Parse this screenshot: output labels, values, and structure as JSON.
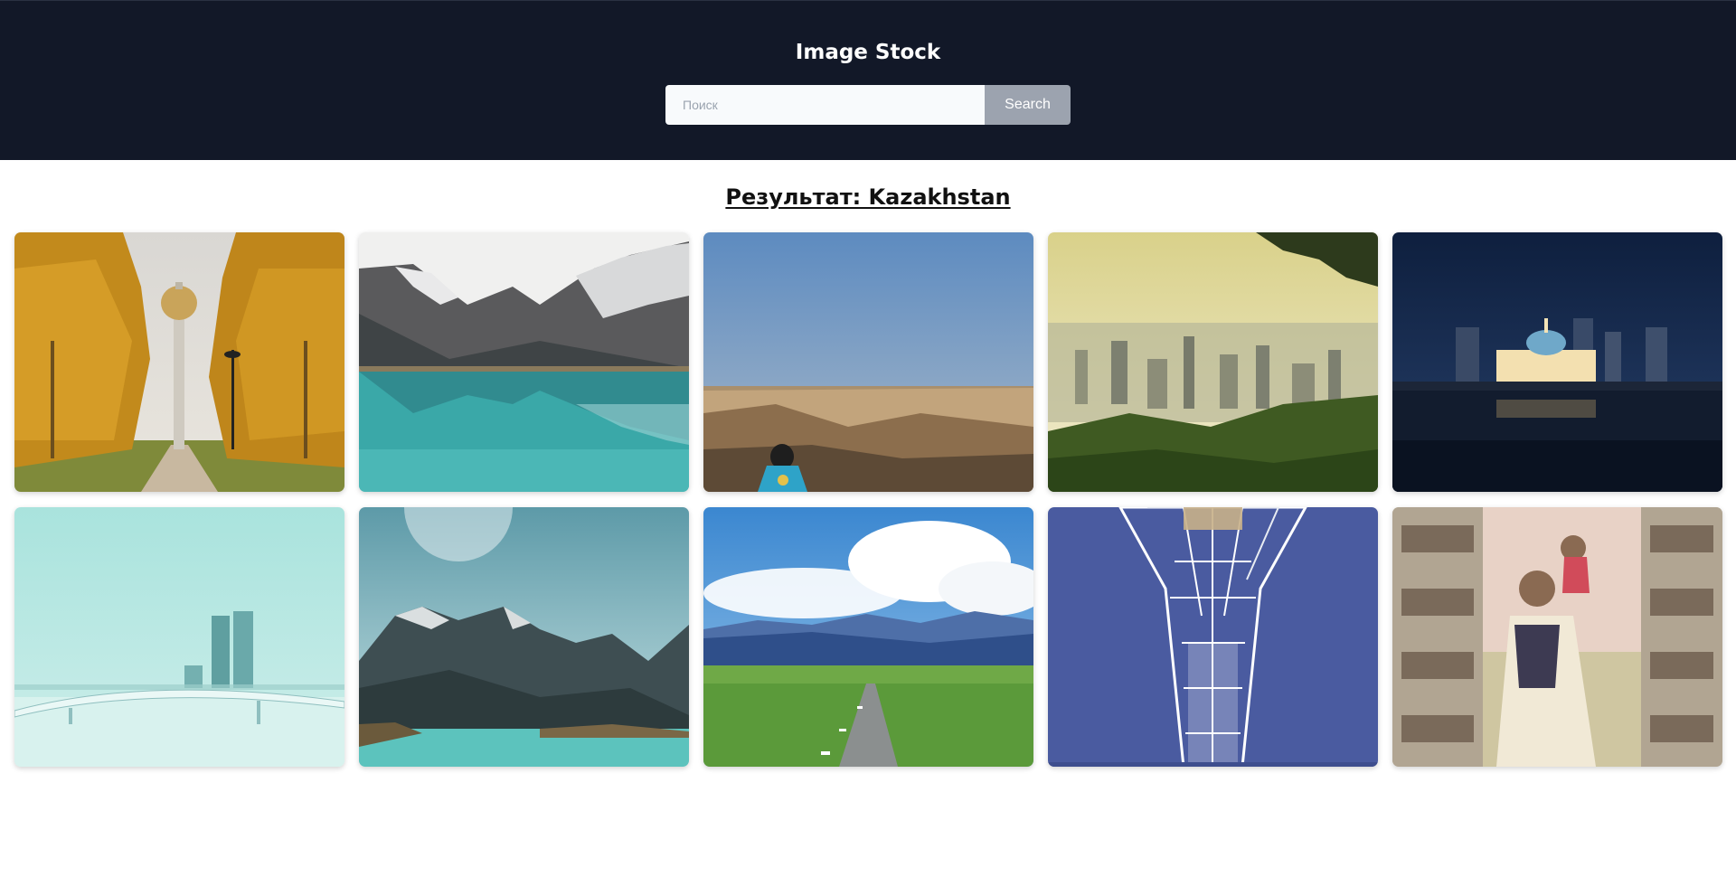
{
  "header": {
    "title": "Image Stock",
    "background": "#121828"
  },
  "search": {
    "placeholder": "Поиск",
    "value": "",
    "button_label": "Search"
  },
  "results": {
    "heading": "Результат: Kazakhstan",
    "images": [
      {
        "name": "image-bayterek-tower-autumn-park"
      },
      {
        "name": "image-mountain-lake-reflection"
      },
      {
        "name": "image-canyon-person-with-flag"
      },
      {
        "name": "image-almaty-city-sunrise"
      },
      {
        "name": "image-palace-at-night"
      },
      {
        "name": "image-frozen-river-bridge"
      },
      {
        "name": "image-big-almaty-lake"
      },
      {
        "name": "image-steppe-road-mountains"
      },
      {
        "name": "image-bayterek-tower-closeup"
      },
      {
        "name": "image-building-mural"
      }
    ]
  }
}
